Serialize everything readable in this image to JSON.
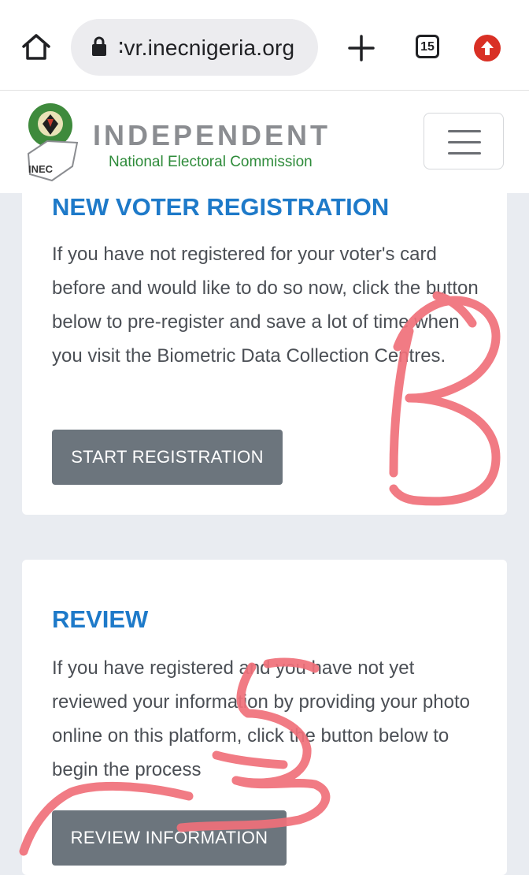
{
  "browser": {
    "url": "∶vr.inecnigeria.org",
    "tab_count": "15",
    "icons": [
      "home-icon",
      "lock-icon",
      "plus-icon",
      "tabs-icon",
      "update-icon"
    ]
  },
  "header": {
    "logo_text": "INEC",
    "brand_title": "INDEPENDENT",
    "brand_subtitle": "National Electoral Commission",
    "menu_icon": "hamburger-menu-icon"
  },
  "cards": [
    {
      "title": "NEW VOTER REGISTRATION",
      "text": "If you have not registered for your voter's card before and would like to do so now, click the button below to pre-register and save a lot of time when you visit the Biometric Data Collection Centres.",
      "button": "START REGISTRATION"
    },
    {
      "title": "REVIEW",
      "text": "If you have registered and you have not yet reviewed your information by providing your photo online on this platform, click the button below to begin the process",
      "button": "REVIEW INFORMATION"
    }
  ],
  "colors": {
    "accent": "#1e7ac9",
    "button": "#6c757d",
    "background": "#e9ecf1",
    "brand_green": "#2e8b3a",
    "scribble": "#f0707a"
  }
}
